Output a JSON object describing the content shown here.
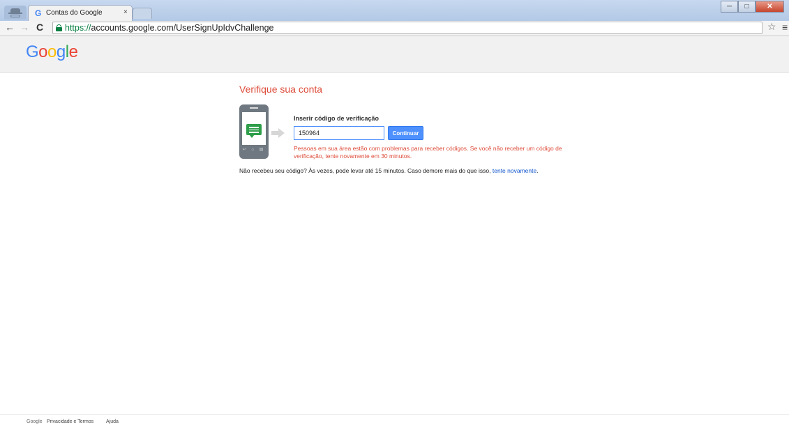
{
  "browser": {
    "tab_title": "Contas do Google",
    "tab_close": "×",
    "url_protocol": "https://",
    "url_rest": "accounts.google.com/UserSignUpIdvChallenge",
    "icons": [
      "incognito-icon",
      "back-icon",
      "forward-icon",
      "reload-icon",
      "lock-icon",
      "star-icon",
      "menu-icon"
    ]
  },
  "header": {
    "logo_letters": [
      {
        "char": "G",
        "color": "#4285f4"
      },
      {
        "char": "o",
        "color": "#ea4335"
      },
      {
        "char": "o",
        "color": "#fbbc05"
      },
      {
        "char": "g",
        "color": "#4285f4"
      },
      {
        "char": "l",
        "color": "#34a853"
      },
      {
        "char": "e",
        "color": "#ea4335"
      }
    ]
  },
  "verify": {
    "heading": "Verifique sua conta",
    "code_label": "Inserir código de verificação",
    "code_value": "150964",
    "continue_label": "Continuar",
    "error_text": "Pessoas em sua área estão com problemas para receber códigos. Se você não receber um código de verificação, tente novamente em 30 minutos.",
    "note_text": "Não recebeu seu código? Às vezes, pode levar até 15 minutos. Caso demore mais do que isso, ",
    "retry_link": "tente novamente",
    "note_end": "."
  },
  "footer": {
    "google": "Google",
    "privacy": "Privacidade e Termos",
    "help": "Ajuda"
  },
  "colors": {
    "accent_red": "#dd4b39",
    "button_blue": "#4d90fe",
    "link_blue": "#1155cc"
  }
}
